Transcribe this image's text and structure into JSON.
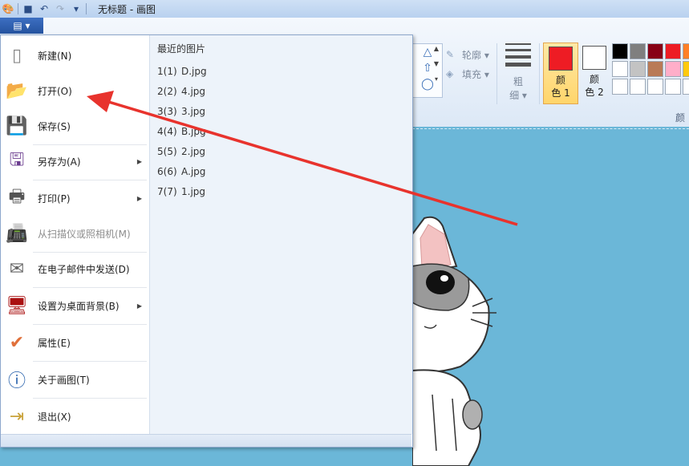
{
  "window": {
    "title": "无标题 - 画图"
  },
  "quick_access": {
    "icons": [
      "paint-app-icon",
      "save-icon",
      "undo-icon",
      "redo-icon",
      "customize-dropdown-icon"
    ]
  },
  "file_button": {
    "label": "▤ ▾"
  },
  "menu": {
    "items": [
      {
        "label": "新建(N)",
        "icon": "new-document-icon"
      },
      {
        "label": "打开(O)",
        "icon": "open-folder-icon"
      },
      {
        "label": "保存(S)",
        "icon": "save-disk-icon"
      },
      {
        "label": "另存为(A)",
        "icon": "save-as-icon",
        "has_submenu": true
      },
      {
        "label": "打印(P)",
        "icon": "printer-icon",
        "has_submenu": true
      },
      {
        "label": "从扫描仪或照相机(M)",
        "icon": "scanner-icon",
        "disabled": true
      },
      {
        "label": "在电子邮件中发送(D)",
        "icon": "email-icon"
      },
      {
        "label": "设置为桌面背景(B)",
        "icon": "desktop-background-icon",
        "has_submenu": true
      },
      {
        "label": "属性(E)",
        "icon": "checkmark-icon"
      },
      {
        "label": "关于画图(T)",
        "icon": "info-icon"
      },
      {
        "label": "退出(X)",
        "icon": "exit-icon"
      }
    ],
    "recent": {
      "title": "最近的图片",
      "files": [
        {
          "num": "1(1)",
          "name": "D.jpg"
        },
        {
          "num": "2(2)",
          "name": "4.jpg"
        },
        {
          "num": "3(3)",
          "name": "3.jpg"
        },
        {
          "num": "4(4)",
          "name": "B.jpg"
        },
        {
          "num": "5(5)",
          "name": "2.jpg"
        },
        {
          "num": "6(6)",
          "name": "A.jpg"
        },
        {
          "num": "7(7)",
          "name": "1.jpg"
        }
      ]
    }
  },
  "ribbon": {
    "outline_label": "轮廓 ▾",
    "fill_label": "填充 ▾",
    "size_label_1": "粗",
    "size_label_2": "细 ▾",
    "color1_label_1": "颜",
    "color1_label_2": "色 1",
    "color2_label_1": "颜",
    "color2_label_2": "色 2",
    "colors_group_label": "颜",
    "color1": "#ee1c24",
    "color2": "#ffffff",
    "palette": [
      "#000000",
      "#7f7f7f",
      "#880015",
      "#ed1c24",
      "#ff7f27",
      "#ffffff",
      "#c3c3c3",
      "#b97a57",
      "#ffaec9",
      "#ffc90e",
      "#ffffff",
      "#ffffff",
      "#ffffff",
      "#ffffff",
      "#ffffff"
    ]
  },
  "canvas": {
    "background": "#6bb7d8"
  }
}
